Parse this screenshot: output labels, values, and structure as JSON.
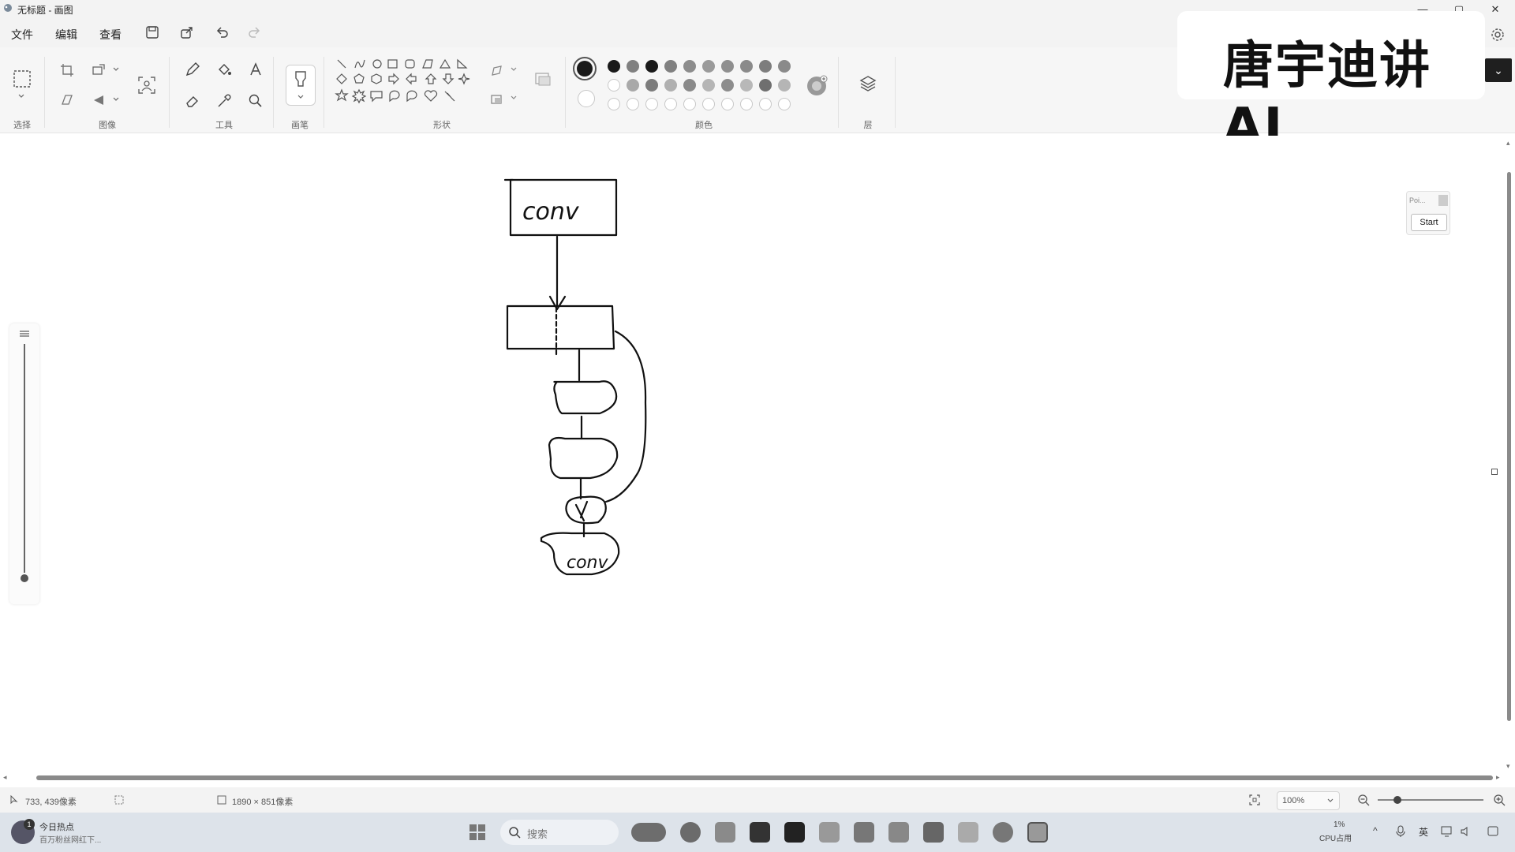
{
  "window": {
    "title": "无标题 - 画图",
    "controls": {
      "minimize": "—",
      "maximize": "▢",
      "close": "✕"
    }
  },
  "menu": {
    "items": [
      "文件",
      "编辑",
      "查看"
    ]
  },
  "ribbon": {
    "groups": {
      "selection": "选择",
      "image": "图像",
      "tools": "工具",
      "brushes": "画笔",
      "shapes": "形状",
      "colors": "颜色",
      "layers": "层"
    },
    "palette_row1": [
      "#1a1a1a",
      "#808080",
      "#1a1a1a",
      "#808080",
      "#8c8c8c",
      "#9a9a9a",
      "#8f8f8f",
      "#8a8a8a",
      "#7d7d7d",
      "#8a8a8a"
    ],
    "palette_row2": [
      "empty",
      "#a9a9a9",
      "#7c7c7c",
      "#b0b0b0",
      "#8a8a8a",
      "#b5b5b5",
      "#8c8c8c",
      "#b8b8b8",
      "#6f6f6f",
      "#b5b5b5"
    ],
    "primary_color": "#1a1a1a"
  },
  "watermark": {
    "text": "唐宇迪讲AI"
  },
  "canvas": {
    "top_label": "conv",
    "bottom_label": "conv"
  },
  "mini_panel": {
    "field": "Poi...",
    "button": "Start"
  },
  "status": {
    "cursor_pos": "733, 439像素",
    "canvas_size": "1890 × 851像素",
    "zoom": "100%"
  },
  "taskbar": {
    "notification_title": "今日热点",
    "notification_sub": "百万粉丝网红下...",
    "notification_badge": "1",
    "search_placeholder": "搜索",
    "cpu_value": "1%",
    "cpu_label": "CPU占用",
    "ime": "英"
  }
}
